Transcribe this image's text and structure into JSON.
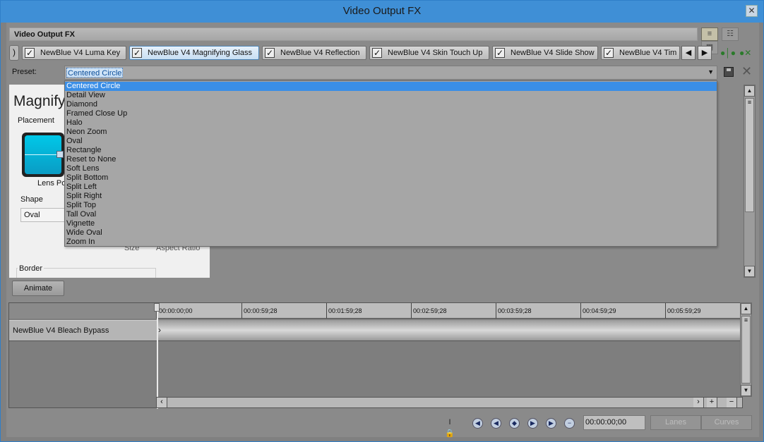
{
  "window": {
    "title": "Video Output FX",
    "close_glyph": "✕"
  },
  "header": {
    "title": "Video Output FX"
  },
  "fx_chain": {
    "tabs": [
      {
        "label": "NewBlue V4 Luma Key",
        "checked": true,
        "selected": false
      },
      {
        "label": "NewBlue V4 Magnifying Glass",
        "checked": true,
        "selected": true
      },
      {
        "label": "NewBlue V4 Reflection",
        "checked": true,
        "selected": false
      },
      {
        "label": "NewBlue V4 Skin Touch Up",
        "checked": true,
        "selected": false
      },
      {
        "label": "NewBlue V4 Slide Show",
        "checked": true,
        "selected": false
      },
      {
        "label": "NewBlue V4 Tim",
        "checked": true,
        "selected": false
      }
    ]
  },
  "preset": {
    "label": "Preset:",
    "value": "Centered Circle",
    "options": [
      "Centered Circle",
      "Detail View",
      "Diamond",
      "Framed Close Up",
      "Halo",
      "Neon Zoom",
      "Oval",
      "Rectangle",
      "Reset to None",
      "Soft Lens",
      "Split Bottom",
      "Split Left",
      "Split Right",
      "Split Top",
      "Tall Oval",
      "Vignette",
      "Wide Oval",
      "Zoom In"
    ],
    "highlighted": "Centered Circle"
  },
  "plugin_panel": {
    "title": "Magnify",
    "placement_label": "Placement",
    "lens_position_label": "Lens Po",
    "shape_label": "Shape",
    "shape_value": "Oval",
    "size_label": "Size",
    "aspect_label": "Aspect Ratio",
    "border_label": "Border"
  },
  "animate_button": "Animate",
  "timeline": {
    "ruler_labels": [
      "00:00:00;00",
      "00:00:59;28",
      "00:01:59;28",
      "00:02:59;28",
      "00:03:59;28",
      "00:04:59;29",
      "00:05:59;29"
    ],
    "track_name": "NewBlue V4 Bleach Bypass"
  },
  "transport": {
    "time_value": "00:00:00;00",
    "lanes_label": "Lanes",
    "curves_label": "Curves"
  }
}
